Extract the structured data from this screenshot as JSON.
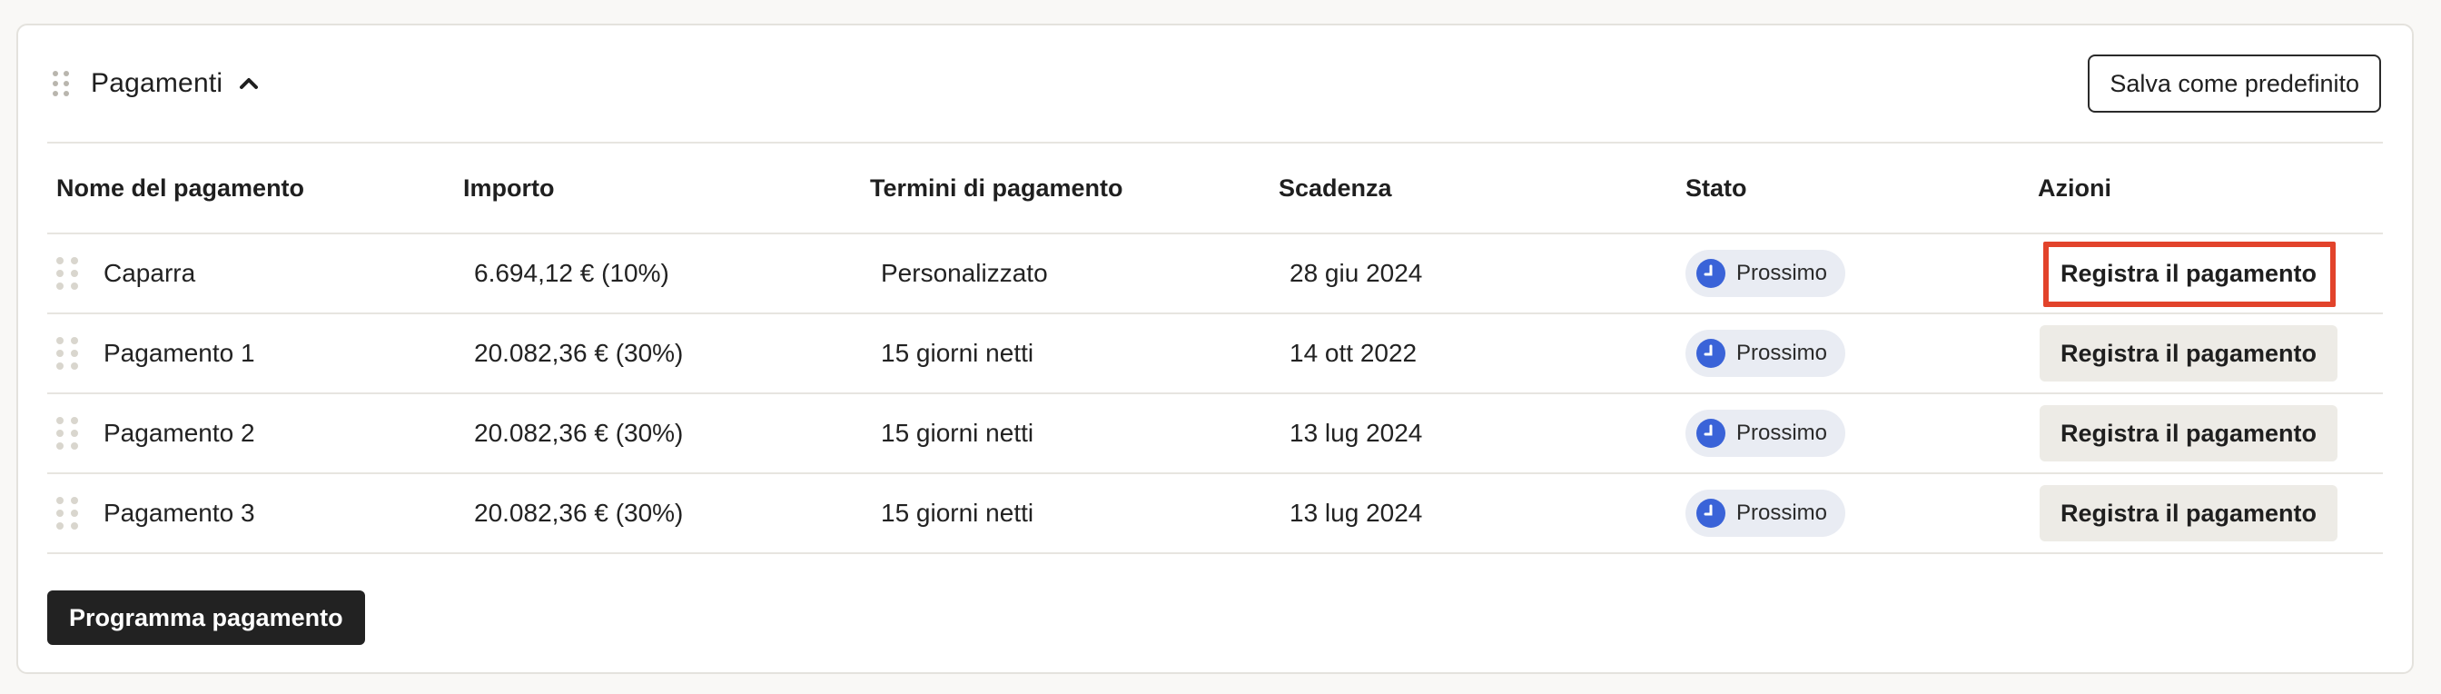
{
  "section": {
    "title": "Pagamenti",
    "save_default_label": "Salva come predefinito"
  },
  "table": {
    "headers": [
      "Nome del pagamento",
      "Importo",
      "Termini di pagamento",
      "Scadenza",
      "Stato",
      "Azioni"
    ],
    "rows": [
      {
        "name": "Caparra",
        "amount": "6.694,12 € (10%)",
        "terms": "Personalizzato",
        "due": "28 giu 2024",
        "status": "Prossimo",
        "action": "Registra il pagamento"
      },
      {
        "name": "Pagamento 1",
        "amount": "20.082,36 € (30%)",
        "terms": "15 giorni netti",
        "due": "14 ott 2022",
        "status": "Prossimo",
        "action": "Registra il pagamento"
      },
      {
        "name": "Pagamento 2",
        "amount": "20.082,36 € (30%)",
        "terms": "15 giorni netti",
        "due": "13 lug 2024",
        "status": "Prossimo",
        "action": "Registra il pagamento"
      },
      {
        "name": "Pagamento 3",
        "amount": "20.082,36 € (30%)",
        "terms": "15 giorni netti",
        "due": "13 lug 2024",
        "status": "Prossimo",
        "action": "Registra il pagamento"
      }
    ]
  },
  "schedule_label": "Programma pagamento",
  "colors": {
    "status_icon": "#3a63d8",
    "highlight": "#e2432b",
    "primary_button": "#222222"
  },
  "icons": {
    "drag": "drag-handle-icon",
    "collapse": "chevron-up-icon",
    "status": "clock-icon"
  }
}
